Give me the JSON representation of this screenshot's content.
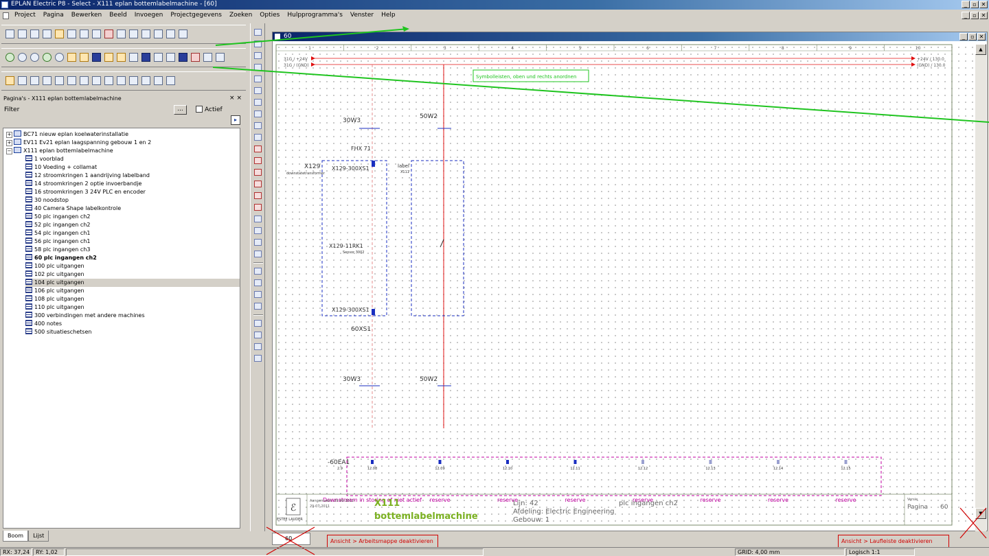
{
  "window": {
    "title": "EPLAN Electric P8 - Select - X111 eplan bottemlabelmachine - [60]",
    "controls": [
      "_",
      "▫",
      "✕"
    ]
  },
  "menu": [
    "Project",
    "Pagina",
    "Bewerken",
    "Beeld",
    "Invoegen",
    "Projectgegevens",
    "Zoeken",
    "Opties",
    "Hulpprogramma's",
    "Venster",
    "Help"
  ],
  "panel": {
    "title": "Pagina's - X111 eplan bottemlabelmachine",
    "filter_label": "Filter",
    "filter_button": "...",
    "active_label": "Actief",
    "tree_button": "▸"
  },
  "tree": {
    "projects": [
      {
        "label": "BC71 nieuw eplan koelwaterinstallatie",
        "expanded": false
      },
      {
        "label": "EV11 Ev21 eplan laagspanning gebouw 1 en 2",
        "expanded": false
      },
      {
        "label": "X111 eplan bottemlabelmachine",
        "expanded": true
      }
    ],
    "pages": [
      {
        "label": "1 voorblad",
        "bold": false,
        "selected": false
      },
      {
        "label": "10 Voeding + collamat",
        "bold": false,
        "selected": false
      },
      {
        "label": "12 stroomkringen 1 aandrijving labelband",
        "bold": false,
        "selected": false
      },
      {
        "label": "14 stroomkringen 2 optie invoerbandje",
        "bold": false,
        "selected": false
      },
      {
        "label": "16 stroomkringen 3 24V PLC en encoder",
        "bold": false,
        "selected": false
      },
      {
        "label": "30 noodstop",
        "bold": false,
        "selected": false
      },
      {
        "label": "40 Camera Shape labelkontrole",
        "bold": false,
        "selected": false
      },
      {
        "label": "50 plc ingangen ch2",
        "bold": false,
        "selected": false
      },
      {
        "label": "52 plc ingangen ch2",
        "bold": false,
        "selected": false
      },
      {
        "label": "54 plc ingangen ch1",
        "bold": false,
        "selected": false
      },
      {
        "label": "56 plc ingangen ch1",
        "bold": false,
        "selected": false
      },
      {
        "label": "58 plc ingangen ch3",
        "bold": false,
        "selected": false
      },
      {
        "label": "60 plc ingangen ch2",
        "bold": true,
        "selected": false
      },
      {
        "label": "100 plc uitgangen",
        "bold": false,
        "selected": false
      },
      {
        "label": "102 plc uitgangen",
        "bold": false,
        "selected": false
      },
      {
        "label": "104 plc uitgangen",
        "bold": false,
        "selected": true
      },
      {
        "label": "106 plc uitgangen",
        "bold": false,
        "selected": false
      },
      {
        "label": "108 plc uitgangen",
        "bold": false,
        "selected": false
      },
      {
        "label": "110 plc uitgangen",
        "bold": false,
        "selected": false
      },
      {
        "label": "300 verbindingen met andere machines",
        "bold": false,
        "selected": false
      },
      {
        "label": "400 notes",
        "bold": false,
        "selected": false
      },
      {
        "label": "500 situatieschetsen",
        "bold": false,
        "selected": false
      }
    ]
  },
  "panel_tabs": [
    "Boom",
    "Lijst"
  ],
  "mdi": {
    "title": "60",
    "bottom_tab": "60"
  },
  "schematic": {
    "column_numbers": [
      "1",
      "2",
      "3",
      "4",
      "5",
      "6",
      "7",
      "8",
      "9",
      "10"
    ],
    "left_potentials": [
      "31G / +24V",
      "31G / (GND)"
    ],
    "right_potentials": [
      "+24V / 130.0",
      "(GND) / 130.0"
    ],
    "annotation_green": "Symbolleisten, oben und rechts anordnen",
    "labels": {
      "w1a": "30W3",
      "w1b": "30W3",
      "w2a": "50W2",
      "w2b": "50W2",
      "k1": "FHX 71",
      "x129": "X129",
      "x129_sub": "downstatetransformer",
      "xs1a": "X129-300XS1",
      "xs1b": "X129-300XS1",
      "label_box": "label",
      "label_box_sub": "X111",
      "dev": "X129-11RK1",
      "dev_sub": "Sensor 3002",
      "xs60": "60XS1",
      "ea": "-60EA1",
      "ea_sub": "2.9"
    },
    "plc_channels": [
      "12.08",
      "12.09",
      "12.10",
      "12.11",
      "12.12",
      "12.13",
      "12.14",
      "12.15"
    ],
    "plc_descriptions": [
      "Downstream in storing of niet actief",
      "reserve",
      "reserve",
      "reserve",
      "reserve",
      "reserve",
      "reserve",
      "reserve"
    ],
    "title_block": {
      "company": "ESTEE LAUDER",
      "drawn": "Aangemaakt: 29-09-2011",
      "date": "29-07-2011",
      "project_code": "X111",
      "project_name": "bottemlabelmachine",
      "line": "Lijn: 42",
      "department": "Afdeling: Electric Engineering",
      "building": "Gebouw: 1",
      "page_desc": "plc ingangen ch2",
      "page_label": "Pagina",
      "page_no": "60",
      "status": "Versie"
    }
  },
  "overlay_annotations": {
    "left": "Ansicht > Arbeitsmappe deaktivieren",
    "right": "Ansicht > Laufleiste deaktivieren"
  },
  "statusbar": {
    "rx": "RX: 37,24",
    "ry": "RY: 1,02",
    "grid": "GRID: 4,00 mm",
    "logic": "Logisch 1:1"
  },
  "colors": {
    "title_blue": "#0a246a",
    "annotation_green": "#1fc41f",
    "annotation_red": "#d00000",
    "wire_red": "#e01010",
    "box_blue": "#1a2ec0",
    "plc_magenta": "#c000a0"
  }
}
